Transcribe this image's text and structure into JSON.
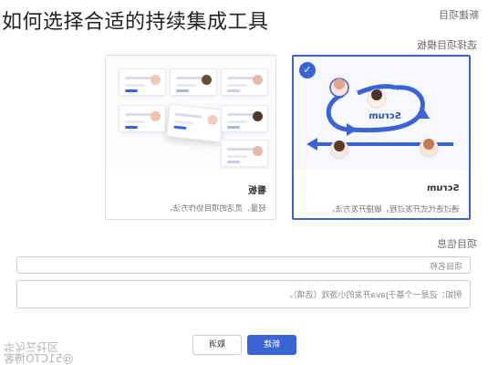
{
  "article": {
    "title": "如何选择合适的持续集成工具"
  },
  "dialog": {
    "heading": "新建项目",
    "template_section_label": "选择项目模板",
    "info_section_label": "项目信息"
  },
  "templates": [
    {
      "name": "看板",
      "description": "轻量、灵活的项目协作方法。",
      "selected": false
    },
    {
      "name": "Scrum",
      "description": "通过迭代式开发过程，敏捷开发方法。",
      "selected": true,
      "diagram_label": "Scrum"
    }
  ],
  "form": {
    "name_placeholder": "项目名称",
    "description_placeholder": "例如：这是一个基于Java开发的小游戏（选填）。"
  },
  "buttons": {
    "cancel": "取消",
    "create": "新建"
  },
  "watermark": {
    "line1": "华为云社区",
    "line2": "@51CTO博客"
  },
  "colors": {
    "accent": "#3a63d6",
    "border": "#c9ccd3"
  }
}
